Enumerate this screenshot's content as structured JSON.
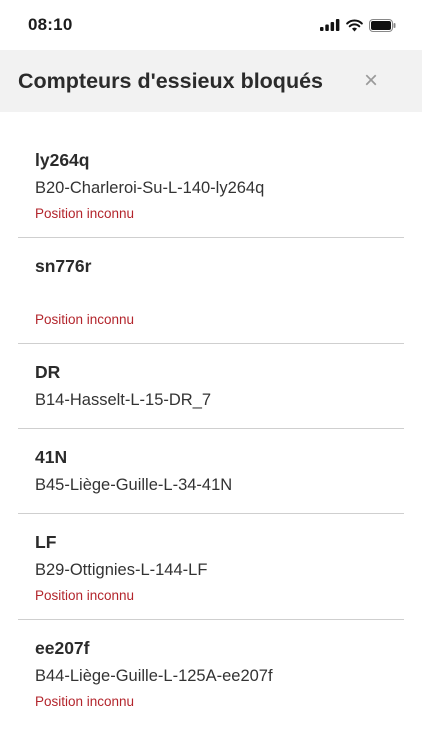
{
  "status_bar": {
    "time": "08:10"
  },
  "header": {
    "title": "Compteurs d'essieux bloqués",
    "close_glyph": "×"
  },
  "items": [
    {
      "id": "ly264q",
      "name": "B20-Charleroi-Su-L-140-ly264q",
      "status": "Position inconnu"
    },
    {
      "id": "sn776r",
      "name": "",
      "status": "Position inconnu"
    },
    {
      "id": "DR",
      "name": "B14-Hasselt-L-15-DR_7",
      "status": ""
    },
    {
      "id": "41N",
      "name": "B45-Liège-Guille-L-34-41N",
      "status": ""
    },
    {
      "id": "LF",
      "name": "B29-Ottignies-L-144-LF",
      "status": "Position inconnu"
    },
    {
      "id": "ee207f",
      "name": "B44-Liège-Guille-L-125A-ee207f",
      "status": "Position inconnu"
    }
  ]
}
